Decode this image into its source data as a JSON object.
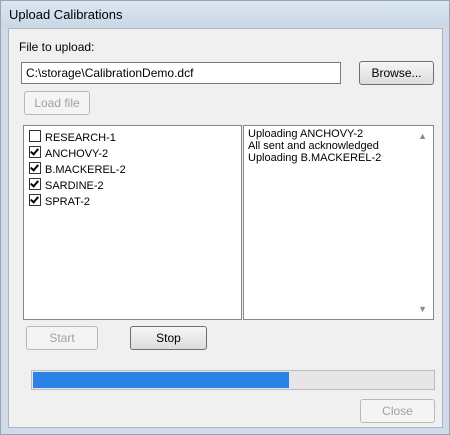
{
  "window": {
    "title": "Upload Calibrations"
  },
  "file": {
    "label": "File to upload:",
    "path": "C:\\storage\\CalibrationDemo.dcf",
    "browse_label": "Browse...",
    "load_label": "Load file"
  },
  "calibrations": [
    {
      "label": "RESEARCH-1",
      "checked": false
    },
    {
      "label": "ANCHOVY-2",
      "checked": true
    },
    {
      "label": "B.MACKEREL-2",
      "checked": true
    },
    {
      "label": "SARDINE-2",
      "checked": true
    },
    {
      "label": "SPRAT-2",
      "checked": true
    }
  ],
  "log": [
    "Uploading   ANCHOVY-2",
    "All sent and acknowledged",
    "Uploading B.MACKEREL-2"
  ],
  "buttons": {
    "start": "Start",
    "stop": "Stop",
    "close": "Close"
  },
  "progress": {
    "fraction": 0.64,
    "color": "#2b82e6"
  }
}
